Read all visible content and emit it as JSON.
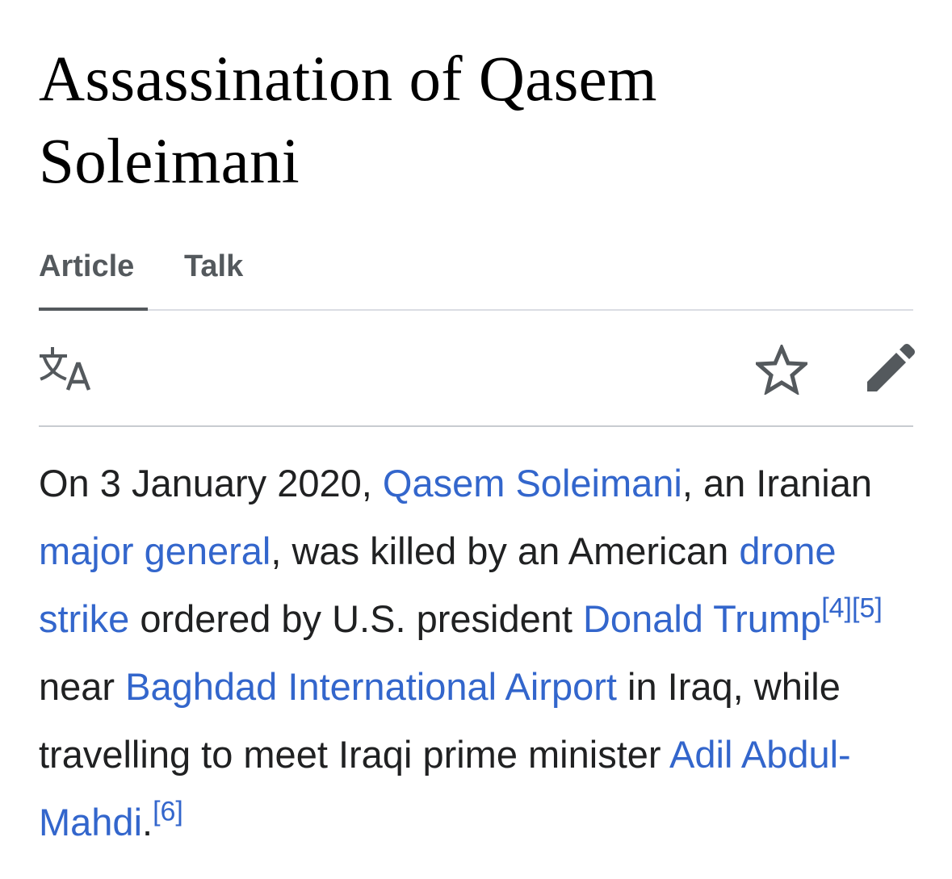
{
  "page": {
    "title_line1": "Assassination of Qasem",
    "title_line2": "Soleimani"
  },
  "tabs": [
    {
      "label": "Article",
      "active": true
    },
    {
      "label": "Talk",
      "active": false
    }
  ],
  "toolbar": {
    "icons": [
      "language-icon",
      "watch-star-icon",
      "edit-pencil-icon"
    ]
  },
  "article": {
    "t1": "On 3 January 2020, ",
    "l1": "Qasem Soleimani",
    "t2": ", an Iranian ",
    "l2": "major general",
    "t3": ", was killed by an American ",
    "l3": "drone strike",
    "t4": " ordered by U.S. president ",
    "l4": "Donald Trump",
    "r1": "[4]",
    "r2": "[5]",
    "t5": " near ",
    "l5": "Baghdad International Airport",
    "t6": " in Iraq, while travelling to meet Iraqi prime minister ",
    "l6": "Adil Abdul-Mahdi",
    "t7": ".",
    "r3": "[6]"
  },
  "colors": {
    "link": "#3366cc",
    "text": "#202122",
    "tab_inactive": "#54595d",
    "divider": "#c8ccd1"
  }
}
